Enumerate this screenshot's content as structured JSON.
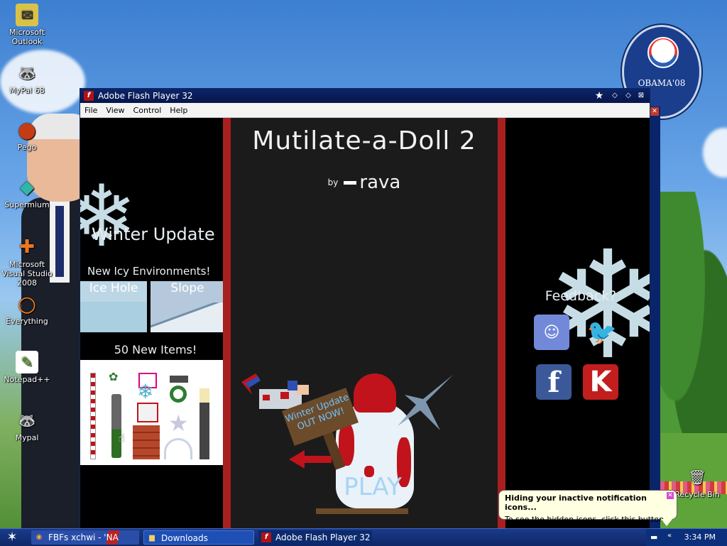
{
  "desktop": {
    "icons": [
      {
        "label": "Microsoft Outlook",
        "glyph": "✉",
        "color": "#d9c24a"
      },
      {
        "label": "MyPal 68",
        "glyph": "🦝",
        "color": "#8b7a5c"
      },
      {
        "label": "Pego",
        "glyph": "●",
        "color": "#c73b12"
      },
      {
        "label": "Supermium",
        "glyph": "◆",
        "color": "#2fb6a6"
      },
      {
        "label": "Microsoft Visual Studio 2008",
        "glyph": "✚",
        "color": "#e87722"
      },
      {
        "label": "Everything",
        "glyph": "○",
        "color": "#f07b18"
      },
      {
        "label": "Notepad++",
        "glyph": "✎",
        "color": "#7ac143"
      },
      {
        "label": "Mypal",
        "glyph": "🦝",
        "color": "#8b7a5c"
      }
    ],
    "obama_text": "OBAMA'08",
    "recycle_label": "Recycle Bin"
  },
  "window": {
    "title": "Adobe Flash Player 32",
    "menu": [
      "File",
      "View",
      "Control",
      "Help"
    ]
  },
  "game": {
    "left": {
      "winter_title": "Winter Update",
      "new_icy": "New Icy Environments!",
      "env_ice": "Ice Hole",
      "env_slope": "Slope",
      "items_title": "50 New Items!"
    },
    "center": {
      "title": "Mutilate-a-Doll 2",
      "by": "by",
      "author": "rava",
      "sign": "Winter Update OUT NOW!",
      "play": "PLAY"
    },
    "right": {
      "feedback": "Feedback?",
      "discord_glyph": "☺",
      "twitter_glyph": "🐦",
      "facebook_glyph": "f",
      "kong_glyph": "K"
    }
  },
  "taskbar": {
    "items": [
      "FBFs xchwi - 'NA",
      "Downloads",
      "Adobe Flash Player 32"
    ],
    "clock": "3:34 PM"
  },
  "balloon": {
    "title": "Hiding your inactive notification icons...",
    "text": "To see the hidden icons, click this button."
  }
}
